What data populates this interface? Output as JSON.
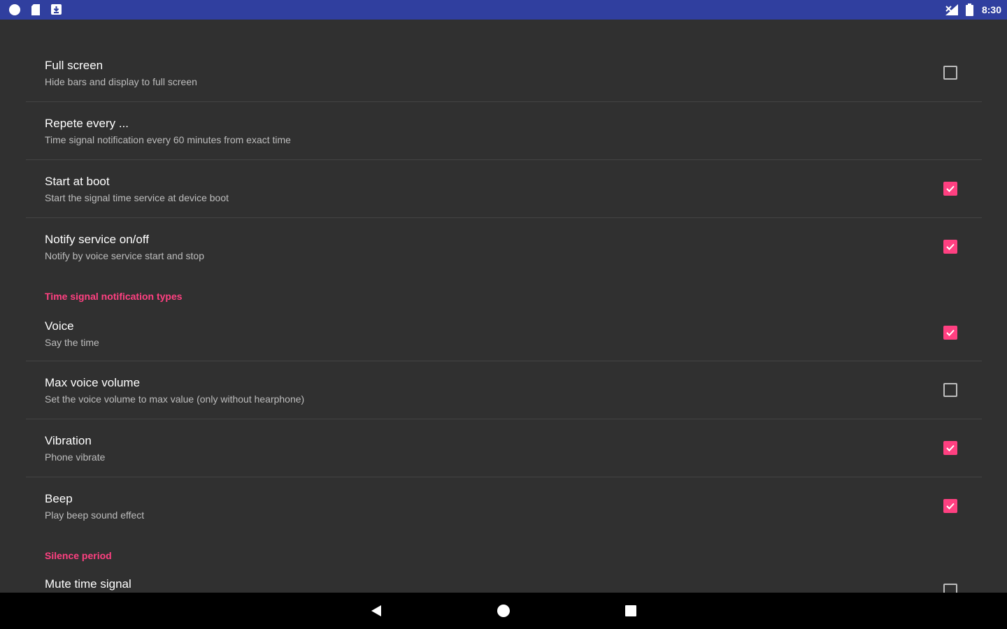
{
  "status_bar": {
    "time": "8:30",
    "left_icons": [
      "circle-notification-icon",
      "sd-card-icon",
      "download-icon"
    ],
    "right_icons": [
      "signal-icon",
      "battery-icon"
    ]
  },
  "colors": {
    "status_bar": "#303f9f",
    "background": "#303030",
    "accent": "#ff4081",
    "divider": "#444444",
    "nav_bar": "#000000"
  },
  "preferences": [
    {
      "title": "Full screen",
      "summary": "Hide bars and display to full screen",
      "checkbox": false
    },
    {
      "title": "Repete every ...",
      "summary": "Time signal notification every 60 minutes from exact time"
    },
    {
      "title": "Start at boot",
      "summary": "Start the signal time service at device boot",
      "checkbox": true
    },
    {
      "title": "Notify service on/off",
      "summary": "Notify by voice service start and stop",
      "checkbox": true
    }
  ],
  "category_notification": "Time signal notification types",
  "notification_prefs": [
    {
      "title": "Voice",
      "summary": "Say the time",
      "checkbox": true
    },
    {
      "title": "Max voice volume",
      "summary": "Set the voice volume to max value (only without hearphone)",
      "checkbox": false
    },
    {
      "title": "Vibration",
      "summary": "Phone vibrate",
      "checkbox": true
    },
    {
      "title": "Beep",
      "summary": "Play beep sound effect",
      "checkbox": true
    }
  ],
  "category_silence": "Silence period",
  "silence_prefs": [
    {
      "title": "Mute time signal",
      "checkbox": false
    }
  ],
  "nav_bar": {
    "icons": [
      "back-icon",
      "home-icon",
      "recents-icon"
    ]
  }
}
